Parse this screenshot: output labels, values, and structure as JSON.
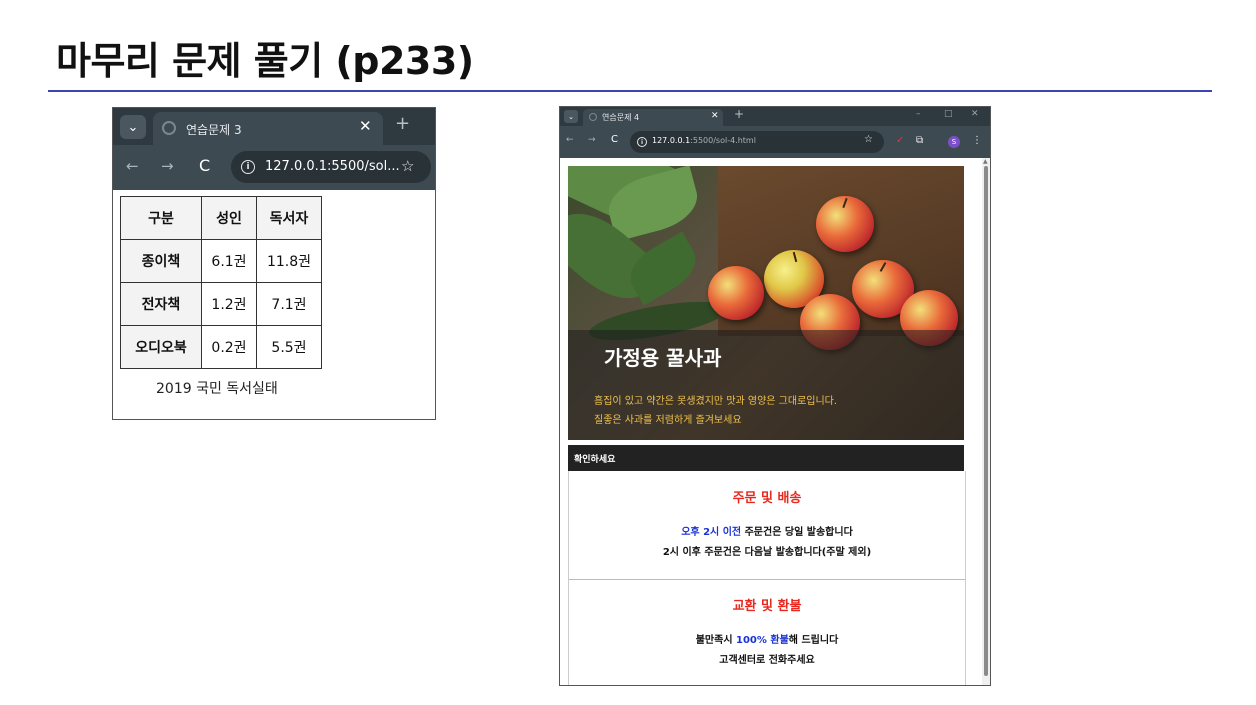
{
  "slide": {
    "title": "마무리 문제 풀기 (p233)"
  },
  "browser1": {
    "menu_icon": "⌄",
    "tab_title": "연습문제 3",
    "tab_close": "✕",
    "new_tab": "+",
    "nav": {
      "back": "←",
      "forward": "→",
      "reload": "C"
    },
    "url": "127.0.0.1:5500/sol...",
    "info_icon": "i",
    "star": "☆",
    "table": {
      "headers": [
        "구분",
        "성인",
        "독서자"
      ],
      "rows": [
        [
          "종이책",
          "6.1권",
          "11.8권"
        ],
        [
          "전자책",
          "1.2권",
          "7.1권"
        ],
        [
          "오디오북",
          "0.2권",
          "5.5권"
        ]
      ],
      "caption": "2019 국민 독서실태"
    }
  },
  "browser2": {
    "menu_icon": "⌄",
    "tab_title": "연습문제 4",
    "tab_close": "✕",
    "new_tab": "+",
    "window_controls": {
      "minimize": "–",
      "maximize": "□",
      "close": "✕"
    },
    "nav": {
      "back": "←",
      "forward": "→",
      "reload": "C"
    },
    "url_host": "127.0.0.1",
    "url_path": ":5500/sol-4.html",
    "info_icon": "i",
    "star": "☆",
    "toolbar_icons": {
      "pen": "✓",
      "extensions": "⧉",
      "profile": "S",
      "more": "⋮"
    },
    "hero": {
      "title": "가정용 꿀사과",
      "line1": "흠집이 있고 약간은 못생겼지만 맛과 영양은 그대로입니다.",
      "line2": "질좋은 사과를 저렴하게 즐겨보세요"
    },
    "notice": "확인하세요",
    "shipping": {
      "title": "주문 및 배송",
      "line1_highlight": "오후 2시 이전",
      "line1_rest": " 주문건은 당일 발송합니다",
      "line2": "2시 이후 주문건은 다음날 발송합니다(주말 제외)"
    },
    "refund": {
      "title": "교환 및 환불",
      "line1_pre": "불만족시 ",
      "line1_highlight": "100% 환불",
      "line1_post": "해 드립니다",
      "line2": "고객센터로 전화주세요"
    }
  },
  "colors": {
    "title_rule": "#3b46b4",
    "browser_chrome": "#2f3a40",
    "section_title": "#e8281e",
    "highlight_blue": "#1a33d6",
    "hero_subtitle": "#f0c24a"
  }
}
